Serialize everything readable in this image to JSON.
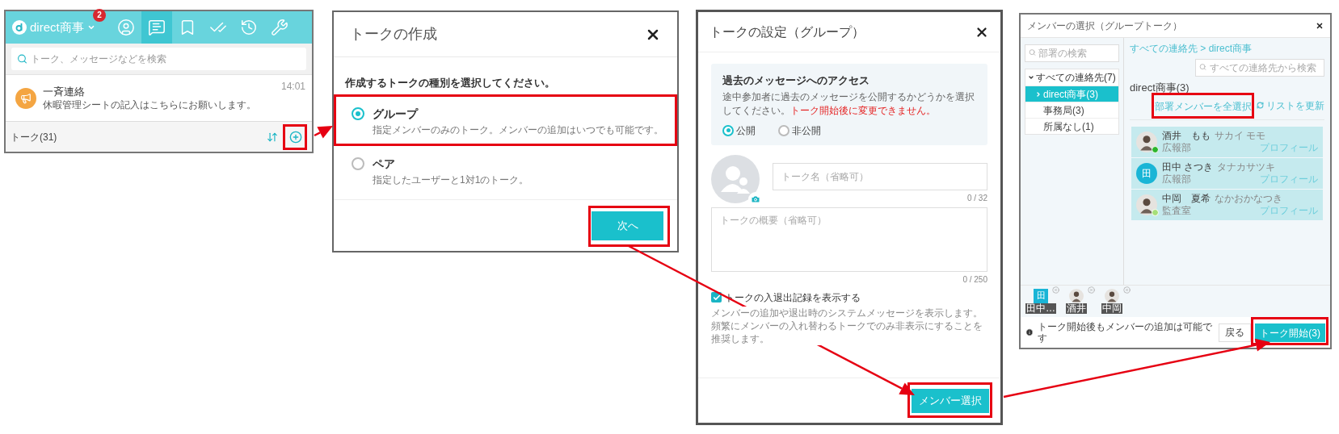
{
  "talk_list": {
    "workspace": "direct商事",
    "badge": "2",
    "nav": [
      {
        "selected": false
      },
      {
        "selected": true
      },
      {
        "selected": false
      },
      {
        "selected": false
      },
      {
        "selected": false
      },
      {
        "selected": false
      }
    ],
    "search": {
      "placeholder": "トーク、メッセージなどを検索"
    },
    "items": [
      {
        "name": "一斉連絡",
        "preview": "休暇管理シートの記入はこちらにお願いします。",
        "time": "14:01"
      }
    ],
    "footer": {
      "label": "トーク(31)",
      "add_highlighted": true
    }
  },
  "create_dialog": {
    "title": "トークの作成",
    "prompt": "作成するトークの種別を選択してください。",
    "options": [
      {
        "label": "グループ",
        "description": "指定メンバーのみのトーク。メンバーの追加はいつでも可能です。",
        "selected": true,
        "highlighted": true
      },
      {
        "label": "ペア",
        "description": "指定したユーザーと1対1のトーク。",
        "selected": false,
        "highlighted": false
      }
    ],
    "next_button": {
      "label": "次へ",
      "highlighted": true
    }
  },
  "settings_dialog": {
    "title": "トークの設定（グループ）",
    "access": {
      "heading": "過去のメッセージへのアクセス",
      "description": "途中参加者に過去のメッセージを公開するかどうかを選択してください。",
      "warning": "トーク開始後に変更できません。",
      "options": [
        {
          "label": "公開",
          "selected": true
        },
        {
          "label": "非公開",
          "selected": false
        }
      ]
    },
    "name_field": {
      "placeholder": "トーク名（省略可）",
      "counter": "0 / 32"
    },
    "summary_field": {
      "placeholder": "トークの概要（省略可）",
      "counter": "0 / 250"
    },
    "log_option": {
      "label": "トークの入退出記録を表示する",
      "checked": true,
      "description": "メンバーの追加や退出時のシステムメッセージを表示します。頻繁にメンバーの入れ替わるトークでのみ非表示にすることを推奨します。"
    },
    "submit_button": {
      "label": "メンバー選択",
      "highlighted": true
    }
  },
  "member_dialog": {
    "title": "メンバーの選択（グループトーク）",
    "department_search": {
      "placeholder": "部署の検索"
    },
    "tree": {
      "label": "すべての連絡先(7)",
      "expanded": true,
      "children": [
        {
          "label": "direct商事(3)",
          "selected": true
        },
        {
          "label": "事務局(3)",
          "selected": false
        },
        {
          "label": "所属なし(1)",
          "selected": false
        }
      ]
    },
    "breadcrumb": "すべての連絡先 > direct商事",
    "contact_search": {
      "placeholder": "すべての連絡先から検索"
    },
    "group_title": "direct商事(3)",
    "select_all": {
      "label": "部署メンバーを全選択",
      "highlighted": true
    },
    "refresh": {
      "label": "リストを更新"
    },
    "members": [
      {
        "name": "酒井　もも",
        "reading": "サカイ モモ",
        "department": "広報部",
        "profile": "プロフィール",
        "kind": "photo",
        "color": "#2cb52c"
      },
      {
        "name": "田中 さつき",
        "reading": "タナカサツキ",
        "department": "広報部",
        "profile": "プロフィール",
        "kind": "initial",
        "initial": "田"
      },
      {
        "name": "中岡　夏希",
        "reading": "なかおかなつき",
        "department": "監査室",
        "profile": "プロフィール",
        "kind": "photo",
        "color": "#a6df7a"
      }
    ],
    "chips": [
      {
        "label": "田中…",
        "kind": "initial",
        "initial": "田"
      },
      {
        "label": "酒井",
        "kind": "photo"
      },
      {
        "label": "中岡",
        "kind": "photo"
      }
    ],
    "note": "トーク開始後もメンバーの追加は可能です",
    "back_button": {
      "label": "戻る"
    },
    "start_button": {
      "label": "トーク開始(3)",
      "highlighted": true
    }
  }
}
